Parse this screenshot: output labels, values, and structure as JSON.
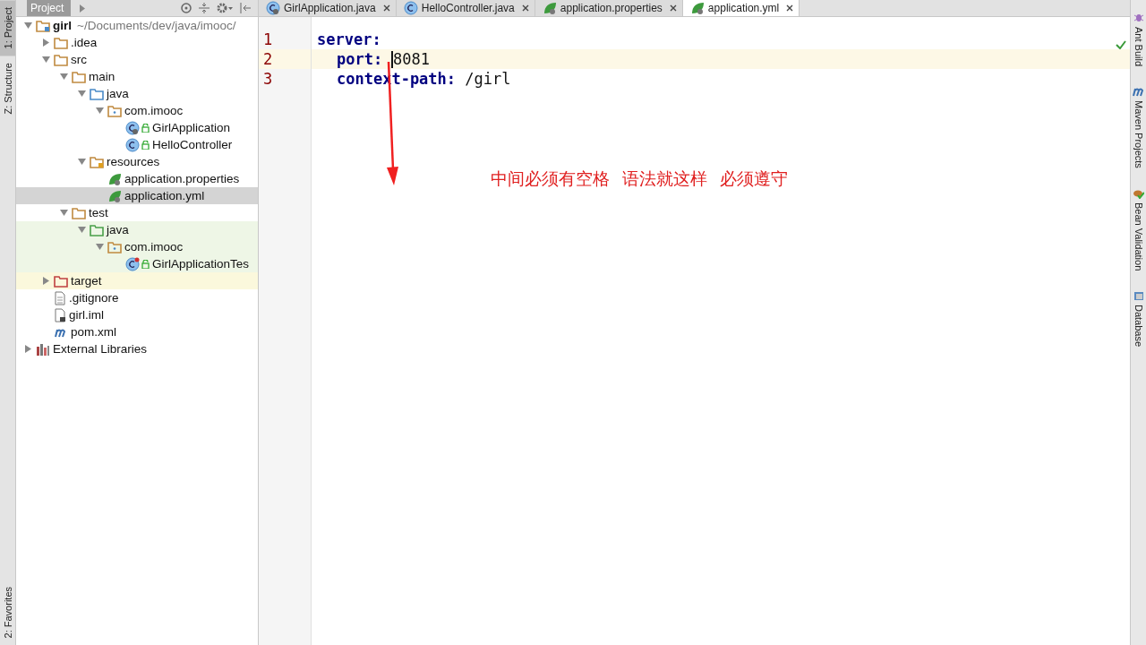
{
  "left_strip": [
    {
      "label": "1: Project",
      "selected": true
    },
    {
      "label": "Z: Structure",
      "selected": false
    }
  ],
  "left_strip_bottom": [
    {
      "label": "2: Favorites",
      "selected": false
    }
  ],
  "project_panel": {
    "title": "Project",
    "tree": [
      {
        "kind": "module",
        "name": "girl",
        "path": "~/Documents/dev/java/imooc/",
        "expanded": true,
        "selected": false,
        "children": [
          {
            "kind": "folder",
            "name": ".idea",
            "expanded": false,
            "selected": false
          },
          {
            "kind": "folder",
            "name": "src",
            "expanded": true,
            "selected": false,
            "children": [
              {
                "kind": "folder",
                "name": "main",
                "expanded": true,
                "selected": false,
                "children": [
                  {
                    "kind": "source-folder",
                    "name": "java",
                    "expanded": true,
                    "selected": false,
                    "children": [
                      {
                        "kind": "package",
                        "name": "com.imooc",
                        "expanded": true,
                        "selected": false,
                        "children": [
                          {
                            "kind": "app-class",
                            "name": "GirlApplication",
                            "selected": false
                          },
                          {
                            "kind": "class",
                            "name": "HelloController",
                            "selected": false
                          }
                        ]
                      }
                    ]
                  },
                  {
                    "kind": "resources-folder",
                    "name": "resources",
                    "expanded": true,
                    "selected": false,
                    "children": [
                      {
                        "kind": "config",
                        "name": "application.properties",
                        "selected": false
                      },
                      {
                        "kind": "config",
                        "name": "application.yml",
                        "selected": true
                      }
                    ]
                  }
                ]
              },
              {
                "kind": "folder",
                "name": "test",
                "expanded": true,
                "selected": false,
                "children": [
                  {
                    "kind": "test-folder",
                    "name": "java",
                    "test_source": true,
                    "expanded": true,
                    "selected": false,
                    "children": [
                      {
                        "kind": "package",
                        "name": "com.imooc",
                        "test_source": true,
                        "expanded": true,
                        "selected": false,
                        "children": [
                          {
                            "kind": "test-class",
                            "name": "GirlApplicationTes",
                            "test_source": true,
                            "selected": false
                          }
                        ]
                      }
                    ]
                  }
                ]
              }
            ]
          },
          {
            "kind": "excluded-folder",
            "name": "target",
            "excluded": true,
            "expanded": false,
            "selected": false
          },
          {
            "kind": "text-file",
            "name": ".gitignore",
            "selected": false
          },
          {
            "kind": "module-file",
            "name": "girl.iml",
            "selected": false
          },
          {
            "kind": "maven-file",
            "name": "pom.xml",
            "selected": false
          }
        ]
      },
      {
        "kind": "libraries",
        "name": "External Libraries",
        "expanded": false,
        "selected": false
      }
    ]
  },
  "tabs": [
    {
      "label": "GirlApplication.java",
      "kind": "app-class",
      "selected": false
    },
    {
      "label": "HelloController.java",
      "kind": "class",
      "selected": false
    },
    {
      "label": "application.properties",
      "kind": "config",
      "selected": false
    },
    {
      "label": "application.yml",
      "kind": "config",
      "selected": true
    }
  ],
  "editor": {
    "lines": [
      {
        "number": "1",
        "key": "server:",
        "current": false,
        "children": [
          {
            "number": "2",
            "key": "port:",
            "value": "8081",
            "current": true
          },
          {
            "number": "3",
            "key": "context-path:",
            "value": "/girl",
            "current": false
          }
        ]
      }
    ]
  },
  "annotation": {
    "notes": [
      "中间必须有空格",
      "语法就这样",
      "必须遵守"
    ]
  },
  "right_strip": [
    {
      "label": "Ant Build",
      "kind": "ant"
    },
    {
      "label": "Maven Projects",
      "kind": "maven"
    },
    {
      "label": "Bean Validation",
      "kind": "bean"
    },
    {
      "label": "Database",
      "kind": "database"
    }
  ]
}
